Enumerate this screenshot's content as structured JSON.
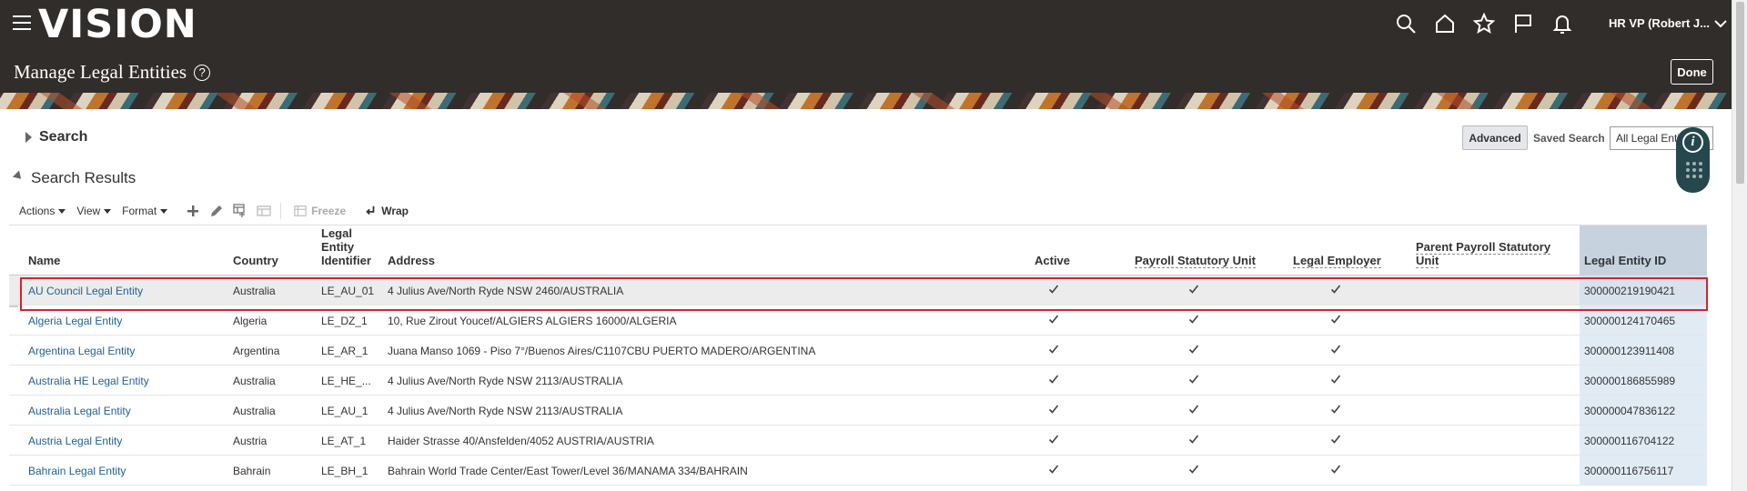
{
  "header": {
    "brand": "VISION",
    "page_title": "Manage Legal Entities",
    "help_symbol": "?",
    "user_label": "HR VP (Robert J...",
    "done_label": "Done",
    "icons": [
      "search-icon",
      "home-icon",
      "favorites-star-icon",
      "flag-icon",
      "notifications-bell-icon"
    ]
  },
  "search": {
    "label": "Search",
    "advanced_label": "Advanced",
    "saved_search_label": "Saved Search",
    "saved_search_value": "All Legal Entities"
  },
  "info_widget": {
    "symbol": "i"
  },
  "results": {
    "label": "Search Results",
    "toolbar": {
      "actions": "Actions",
      "view": "View",
      "format": "Format",
      "freeze": "Freeze",
      "wrap": "Wrap"
    },
    "columns": {
      "name": "Name",
      "country": "Country",
      "identifier": "Legal Entity Identifier",
      "address": "Address",
      "active": "Active",
      "psu": "Payroll Statutory Unit",
      "employer": "Legal Employer",
      "parent_psu": "Parent Payroll Statutory Unit",
      "id": "Legal Entity ID"
    },
    "rows": [
      {
        "name": "AU Council Legal Entity",
        "country": "Australia",
        "identifier": "LE_AU_01",
        "address": "4 Julius Ave/North Ryde NSW 2460/AUSTRALIA",
        "active": true,
        "psu": true,
        "employer": true,
        "parent_psu": "",
        "id": "300000219190421"
      },
      {
        "name": "Algeria Legal Entity",
        "country": "Algeria",
        "identifier": "LE_DZ_1",
        "address": "10, Rue Zirout Youcef/ALGIERS ALGIERS 16000/ALGERIA",
        "active": true,
        "psu": true,
        "employer": true,
        "parent_psu": "",
        "id": "300000124170465"
      },
      {
        "name": "Argentina Legal Entity",
        "country": "Argentina",
        "identifier": "LE_AR_1",
        "address": "Juana Manso 1069 - Piso 7°/Buenos Aires/C1107CBU PUERTO MADERO/ARGENTINA",
        "active": true,
        "psu": true,
        "employer": true,
        "parent_psu": "",
        "id": "300000123911408"
      },
      {
        "name": "Australia HE Legal Entity",
        "country": "Australia",
        "identifier": "LE_HE_...",
        "address": "4 Julius Ave/North Ryde NSW 2113/AUSTRALIA",
        "active": true,
        "psu": true,
        "employer": true,
        "parent_psu": "",
        "id": "300000186855989"
      },
      {
        "name": "Australia Legal Entity",
        "country": "Australia",
        "identifier": "LE_AU_1",
        "address": "4 Julius Ave/North Ryde NSW 2113/AUSTRALIA",
        "active": true,
        "psu": true,
        "employer": true,
        "parent_psu": "",
        "id": "300000047836122"
      },
      {
        "name": "Austria Legal Entity",
        "country": "Austria",
        "identifier": "LE_AT_1",
        "address": "Haider Strasse 40/Ansfelden/4052 AUSTRIA/AUSTRIA",
        "active": true,
        "psu": true,
        "employer": true,
        "parent_psu": "",
        "id": "300000116704122"
      },
      {
        "name": "Bahrain Legal Entity",
        "country": "Bahrain",
        "identifier": "LE_BH_1",
        "address": "Bahrain World Trade Center/East Tower/Level 36/MANAMA 334/BAHRAIN",
        "active": true,
        "psu": true,
        "employer": true,
        "parent_psu": "",
        "id": "300000116756117"
      }
    ]
  },
  "colors": {
    "header_bg": "#312d2a",
    "link": "#1f5f96",
    "selection_outline": "#d6232c",
    "id_column_bg": "#e1ebf4"
  }
}
